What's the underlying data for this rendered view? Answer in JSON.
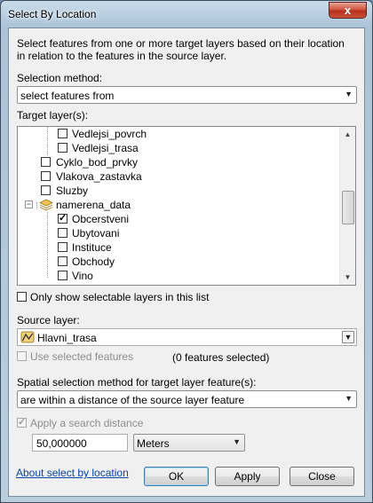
{
  "window": {
    "title": "Select By Location",
    "close_glyph": "x"
  },
  "description": "Select features from one or more target layers based on their location in relation to the features in the source layer.",
  "selection_method": {
    "label": "Selection method:",
    "value": "select features from"
  },
  "target_layers": {
    "label": "Target layer(s):",
    "items": [
      {
        "label": "Vedlejsi_povrch",
        "checked": false
      },
      {
        "label": "Vedlejsi_trasa",
        "checked": false
      },
      {
        "label": "Cyklo_bod_prvky",
        "checked": false
      },
      {
        "label": "Vlakova_zastavka",
        "checked": false
      },
      {
        "label": "Sluzby",
        "checked": false
      },
      {
        "label": "namerena_data",
        "checked": false,
        "group": true,
        "expanded": true
      },
      {
        "label": "Obcerstveni",
        "checked": true
      },
      {
        "label": "Ubytovani",
        "checked": false
      },
      {
        "label": "Instituce",
        "checked": false
      },
      {
        "label": "Obchody",
        "checked": false
      },
      {
        "label": "Vino",
        "checked": false
      }
    ]
  },
  "only_selectable": {
    "label": "Only show selectable layers in this list",
    "checked": false
  },
  "source_layer": {
    "label": "Source layer:",
    "value": "Hlavni_trasa",
    "icon": "line-layer-icon"
  },
  "use_selected": {
    "label": "Use selected features",
    "checked": false,
    "enabled": false,
    "count_text": "(0 features selected)"
  },
  "spatial_method": {
    "label": "Spatial selection method for target layer feature(s):",
    "value": "are within a distance of the source layer feature"
  },
  "search_distance": {
    "label": "Apply a search distance",
    "checked": true,
    "enabled": false,
    "value": "50,000000",
    "unit": "Meters"
  },
  "footer": {
    "help_link": "About select by location",
    "ok": "OK",
    "apply": "Apply",
    "close": "Close"
  },
  "colors": {
    "link": "#0645ad",
    "close_button": "#c9513a"
  }
}
